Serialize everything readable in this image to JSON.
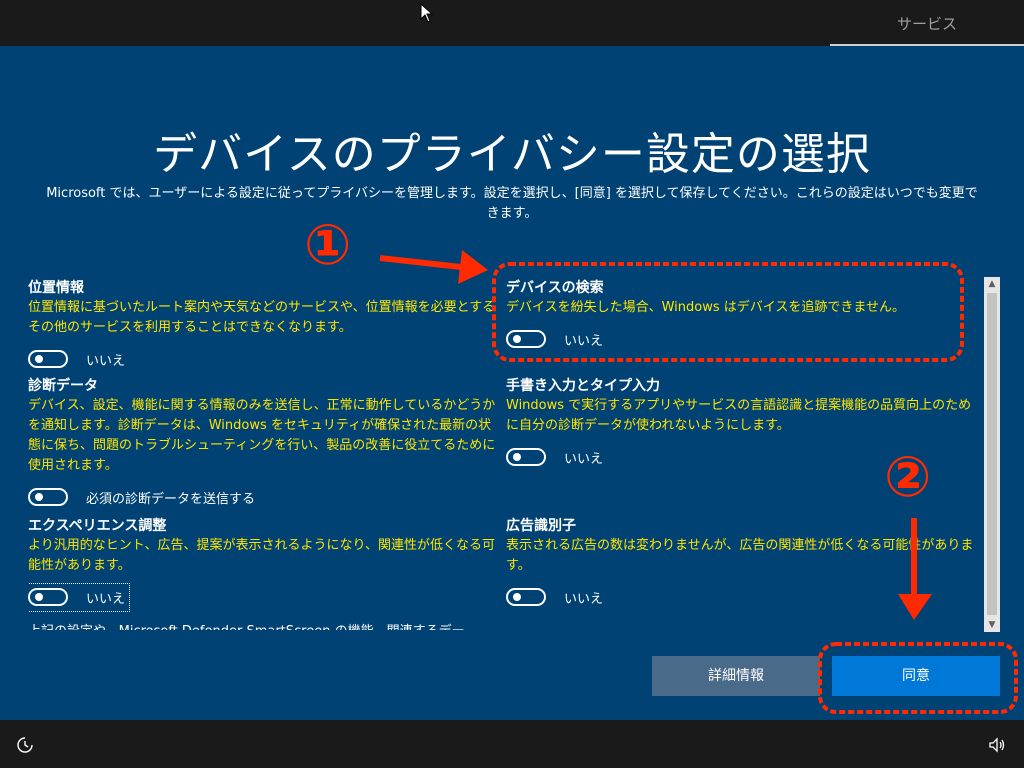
{
  "header": {
    "tab_label": "サービス"
  },
  "title": "デバイスのプライバシー設定の選択",
  "subtitle": "Microsoft では、ユーザーによる設定に従ってプライバシーを管理します。設定を選択し、[同意] を選択して保存してください。これらの設定はいつでも変更できます。",
  "settings": [
    {
      "heading": "位置情報",
      "desc": "位置情報に基づいたルート案内や天気などのサービスや、位置情報を必要とするその他のサービスを利用することはできなくなります。",
      "toggle": "いいえ"
    },
    {
      "heading": "デバイスの検索",
      "desc": "デバイスを紛失した場合、Windows はデバイスを追跡できません。",
      "toggle": "いいえ"
    },
    {
      "heading": "診断データ",
      "desc": "デバイス、設定、機能に関する情報のみを送信し、正常に動作しているかどうかを通知します。診断データは、Windows をセキュリティが確保された最新の状態に保ち、問題のトラブルシューティングを行い、製品の改善に役立てるために使用されます。",
      "toggle": "必須の診断データを送信する"
    },
    {
      "heading": "手書き入力とタイプ入力",
      "desc": "Windows で実行するアプリやサービスの言語認識と提案機能の品質向上のために自分の診断データが使われないようにします。",
      "toggle": "いいえ"
    },
    {
      "heading": "エクスペリエンス調整",
      "desc": "より汎用的なヒント、広告、提案が表示されるようになり、関連性が低くなる可能性があります。",
      "toggle": "いいえ"
    },
    {
      "heading": "広告識別子",
      "desc": "表示される広告の数は変わりませんが、広告の関連性が低くなる可能性があります。",
      "toggle": "いいえ"
    }
  ],
  "footer_note": "上記の設定や、Microsoft Defender SmartScreen の機能、関連するデー",
  "buttons": {
    "details": "詳細情報",
    "agree": "同意"
  },
  "annotations": {
    "marker1": "①",
    "marker2": "②",
    "color": "#ff2a00"
  },
  "colors": {
    "background": "#004274",
    "description": "#ffe600",
    "agree_button": "#0078d7",
    "details_button": "#4a6a8a"
  }
}
